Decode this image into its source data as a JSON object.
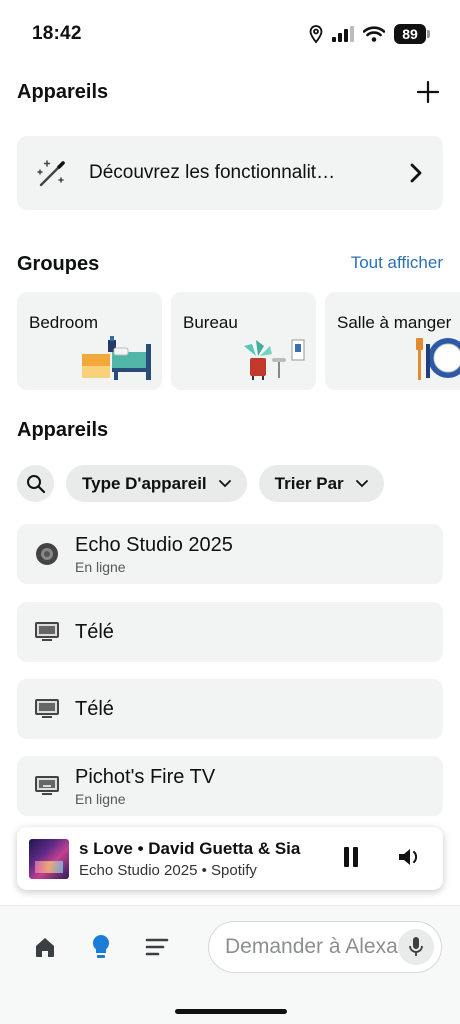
{
  "status_bar": {
    "time": "18:42",
    "battery": "89"
  },
  "header": {
    "title": "Appareils",
    "add_icon": "plus-icon"
  },
  "discover": {
    "label": "Découvrez les fonctionnalit…",
    "icon": "magic-wand-icon"
  },
  "groups": {
    "title": "Groupes",
    "see_all": "Tout afficher",
    "items": [
      {
        "label": "Bedroom"
      },
      {
        "label": "Bureau"
      },
      {
        "label": "Salle à manger"
      }
    ]
  },
  "devices": {
    "title": "Appareils",
    "filters": [
      {
        "label": "Type D'appareil"
      },
      {
        "label": "Trier Par"
      }
    ],
    "items": [
      {
        "name": "Echo Studio 2025",
        "status": "En ligne",
        "icon": "speaker-icon"
      },
      {
        "name": "Télé",
        "status": "",
        "icon": "tv-icon"
      },
      {
        "name": "Télé",
        "status": "",
        "icon": "tv-icon"
      },
      {
        "name": "Pichot's Fire TV",
        "status": "En ligne",
        "icon": "fire-tv-icon"
      }
    ]
  },
  "player": {
    "track": "s Love • David Guetta & Sia",
    "subtitle": "Echo Studio 2025 • Spotify"
  },
  "bottom_nav": {
    "ask_placeholder": "Demander à Alexa"
  },
  "colors": {
    "link": "#2a72b5",
    "accent_bulb": "#1a7bd8"
  }
}
